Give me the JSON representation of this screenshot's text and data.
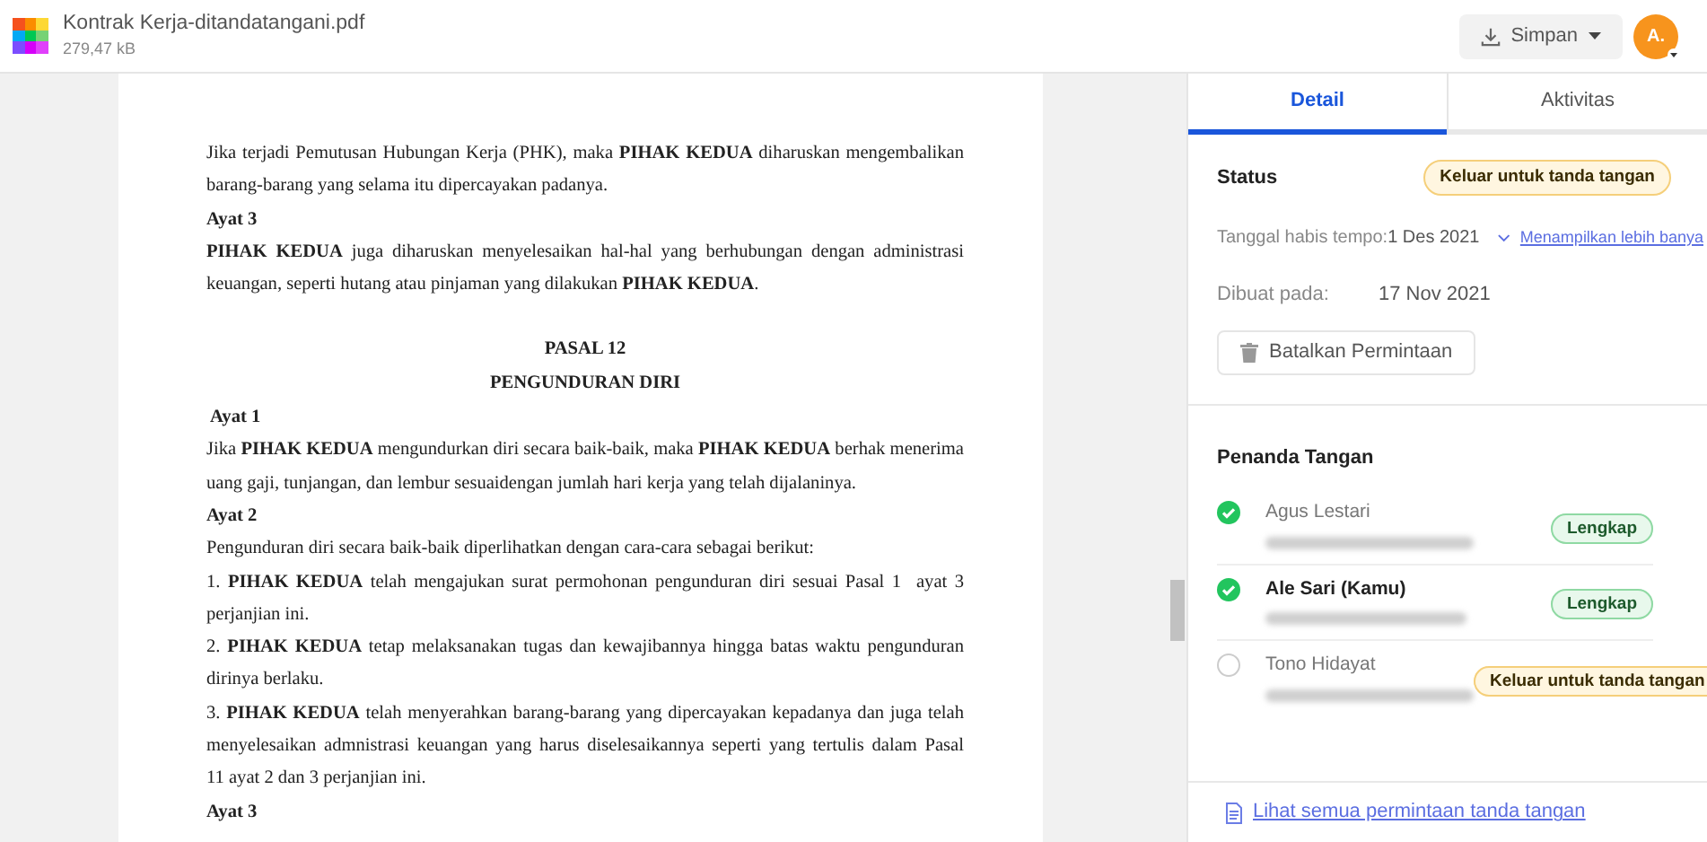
{
  "file": {
    "name": "Kontrak Kerja-ditandatangani.pdf",
    "size": "279,47 kB"
  },
  "toolbar": {
    "save_button": "Simpan",
    "avatar": "A."
  },
  "document": {
    "blocks": [
      {
        "kind": "paragraph",
        "lines": [
          "Jika terjadi Pemutusan Hubungan Kerja (PHK), maka **PIHAK KEDUA** diharuskan mengembalikan",
          "barang-barang yang selama itu dipercayakan padanya."
        ]
      },
      {
        "kind": "subheading",
        "lines": [
          "Ayat 3"
        ]
      },
      {
        "kind": "paragraph",
        "lines": [
          "**PIHAK KEDUA** juga diharuskan menyelesaikan hal-hal yang berhubungan dengan administrasi",
          "keuangan, seperti hutang atau pinjaman yang dilakukan **PIHAK KEDUA**."
        ]
      },
      {
        "kind": "heading",
        "lines": [
          "PASAL 12",
          "PENGUNDURAN DIRI"
        ]
      },
      {
        "kind": "subheading",
        "lines": [
          " Ayat 1"
        ]
      },
      {
        "kind": "paragraph",
        "lines": [
          "Jika **PIHAK KEDUA** mengundurkan diri secara baik-baik, maka **PIHAK KEDUA** berhak menerima",
          "uang gaji, tunjangan, dan lembur sesuaidengan jumlah hari kerja yang telah dijalaninya."
        ]
      },
      {
        "kind": "subheading",
        "lines": [
          "Ayat 2"
        ]
      },
      {
        "kind": "paragraph",
        "lines": [
          "Pengunduran diri secara baik-baik diperlihatkan dengan cara-cara sebagai berikut:"
        ]
      },
      {
        "kind": "paragraph",
        "lines": [
          "1. **PIHAK KEDUA** telah mengajukan surat permohonan pengunduran diri sesuai Pasal 1  ayat 3",
          "perjanjian ini."
        ]
      },
      {
        "kind": "paragraph",
        "lines": [
          "2. **PIHAK KEDUA** tetap melaksanakan tugas dan kewajibannya hingga batas waktu pengunduran",
          "dirinya berlaku."
        ]
      },
      {
        "kind": "paragraph",
        "lines": [
          "3. **PIHAK KEDUA** telah menyerahkan barang-barang yang dipercayakan kepadanya dan juga telah",
          "menyelesaikan admnistrasi keuangan yang harus diselesaikannya seperti yang tertulis dalam Pasal",
          "11 ayat 2 dan 3 perjanjian ini."
        ]
      },
      {
        "kind": "subheading",
        "lines": [
          "Ayat 3"
        ]
      }
    ]
  },
  "tabs": [
    {
      "label": "Detail",
      "selected": true
    },
    {
      "label": "Aktivitas",
      "selected": false
    }
  ],
  "status": {
    "title": "Status",
    "badge": "Keluar untuk tanda tangan",
    "due_label": "Tanggal habis tempo:",
    "due_value": "1 Des 2021",
    "show_more": "Menampilkan lebih banya",
    "created_label": "Dibuat pada:",
    "created_value": "17 Nov 2021",
    "cancel_button": "Batalkan Permintaan"
  },
  "signers": {
    "title": "Penanda Tangan",
    "items": [
      {
        "name": "Agus Lestari",
        "signed": true,
        "is_you": false,
        "badge": "Lengkap",
        "kind": "complete"
      },
      {
        "name": "Ale Sari (Kamu)",
        "signed": true,
        "is_you": true,
        "badge": "Lengkap",
        "kind": "complete"
      },
      {
        "name": "Tono Hidayat",
        "signed": false,
        "is_you": false,
        "badge": "Keluar untuk tanda tangan",
        "kind": "pending"
      }
    ]
  },
  "footer_link": "Lihat semua permintaan tanda tangan"
}
